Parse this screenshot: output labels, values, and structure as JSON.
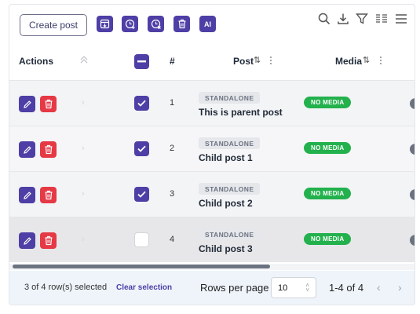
{
  "toolbar": {
    "create_label": "Create post",
    "icons": [
      "export-icon",
      "schedule-add-icon",
      "schedule-remove-icon",
      "delete-selected-icon",
      "ai-icon"
    ],
    "ai_label": "AI",
    "right_icons": [
      "search-icon",
      "download-icon",
      "filter-icon",
      "columns-icon",
      "menu-icon"
    ]
  },
  "header": {
    "actions": "Actions",
    "number": "#",
    "post": "Post",
    "media": "Media",
    "sort_glyph": "⇅"
  },
  "rows": [
    {
      "number": "1",
      "tag": "STANDALONE",
      "title": "This is parent post",
      "media": "NO MEDIA",
      "selected": true
    },
    {
      "number": "2",
      "tag": "STANDALONE",
      "title": "Child post 1",
      "media": "NO MEDIA",
      "selected": true
    },
    {
      "number": "3",
      "tag": "STANDALONE",
      "title": "Child post 2",
      "media": "NO MEDIA",
      "selected": true
    },
    {
      "number": "4",
      "tag": "STANDALONE",
      "title": "Child post 3",
      "media": "NO MEDIA",
      "selected": false
    }
  ],
  "footer": {
    "selected_text": "3 of 4 row(s) selected",
    "clear_label": "Clear selection",
    "rows_per_page_label": "Rows per page",
    "rows_per_page_value": "10",
    "range_text": "1-4 of 4",
    "prev_glyph": "‹",
    "next_glyph": "›"
  },
  "colors": {
    "accent": "#4e3fa6",
    "danger": "#e53945",
    "success": "#22b14c"
  }
}
